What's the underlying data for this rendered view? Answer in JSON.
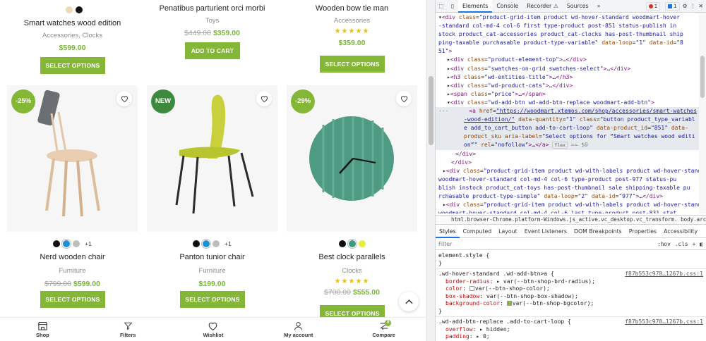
{
  "shop": {
    "top_row": [
      {
        "name": "Smart watches wood edition",
        "category": "Accessories, Clocks",
        "price": "$599.00",
        "old_price": "",
        "button": "SELECT OPTIONS",
        "swatches": [
          "#f0d9b5",
          "#111111"
        ]
      },
      {
        "name": "Penatibus parturient orci morbi",
        "category": "Toys",
        "price": "$359.00",
        "old_price": "$449.00",
        "button": "ADD TO CART"
      },
      {
        "name": "Wooden bow tie man",
        "category": "Accessories",
        "price": "$359.00",
        "old_price": "",
        "button": "SELECT OPTIONS",
        "stars": "★★★★★"
      }
    ],
    "products": [
      {
        "name": "Nerd wooden chair",
        "category": "Furniture",
        "price": "$599.00",
        "old_price": "$799.00",
        "button": "SELECT OPTIONS",
        "badge": "-25%",
        "badge_color": "#83b735",
        "swatches": [
          "#111111",
          "#1e90d6",
          "#bdbdbd"
        ],
        "more": "+1"
      },
      {
        "name": "Panton tunior chair",
        "category": "Furniture",
        "price": "$199.00",
        "old_price": "",
        "button": "SELECT OPTIONS",
        "badge": "NEW",
        "badge_color": "#3d8a3f",
        "swatches": [
          "#111111",
          "#1e90d6",
          "#bdbdbd"
        ],
        "more": "+1"
      },
      {
        "name": "Best clock parallels",
        "category": "Clocks",
        "price": "$555.00",
        "old_price": "$700.00",
        "button": "SELECT OPTIONS",
        "badge": "-29%",
        "badge_color": "#83b735",
        "swatches": [
          "#111111",
          "#3c9b7c",
          "#e7ee3b"
        ],
        "stars": "★★★★★"
      }
    ],
    "bottom_nav": [
      {
        "label": "Shop",
        "icon": "store-icon"
      },
      {
        "label": "Filters",
        "icon": "filter-icon"
      },
      {
        "label": "Wishlist",
        "icon": "heart-icon"
      },
      {
        "label": "My account",
        "icon": "user-icon"
      },
      {
        "label": "Compare",
        "icon": "compare-icon",
        "badge": "0"
      }
    ],
    "accent": "#83b735"
  },
  "devtools": {
    "tabs": [
      "Elements",
      "Console",
      "Recorder ⚠",
      "Sources",
      "»"
    ],
    "active_tab": "Elements",
    "errors": "1",
    "messages": "1",
    "breadcrumb": "html.browser-Chrome.platform-Windows.js_active.vc_desktop.vc_transform.   body.archive.post-typ",
    "styles_tabs": [
      "Styles",
      "Computed",
      "Layout",
      "Event Listeners",
      "DOM Breakpoints",
      "Properties",
      "Accessibility"
    ],
    "filter_placeholder": "Filter",
    "filter_tools": [
      ":hov",
      ".cls",
      "+"
    ],
    "rules": [
      {
        "selector": "element.style {",
        "source": "",
        "props": []
      },
      {
        "selector": ".wd-hover-standard .wd-add-btn>a {",
        "source": "f87b553c978…1267b.css:1",
        "props": [
          {
            "name": "border-radius",
            "value": "▸ var(--btn-shop-brd-radius);"
          },
          {
            "name": "color",
            "value": "var(--btn-shop-color);"
          },
          {
            "name": "box-shadow",
            "value": "var(--btn-shop-box-shadow);"
          },
          {
            "name": "background-color",
            "value": "var(--btn-shop-bgcolor);"
          }
        ]
      },
      {
        "selector": ".wd-add-btn-replace .add-to-cart-loop {",
        "source": "f87b553c978…1267b.css:1",
        "props": [
          {
            "name": "overflow",
            "value": "▸ hidden;"
          },
          {
            "name": "padding",
            "value": "▸ 0;"
          }
        ]
      }
    ]
  }
}
